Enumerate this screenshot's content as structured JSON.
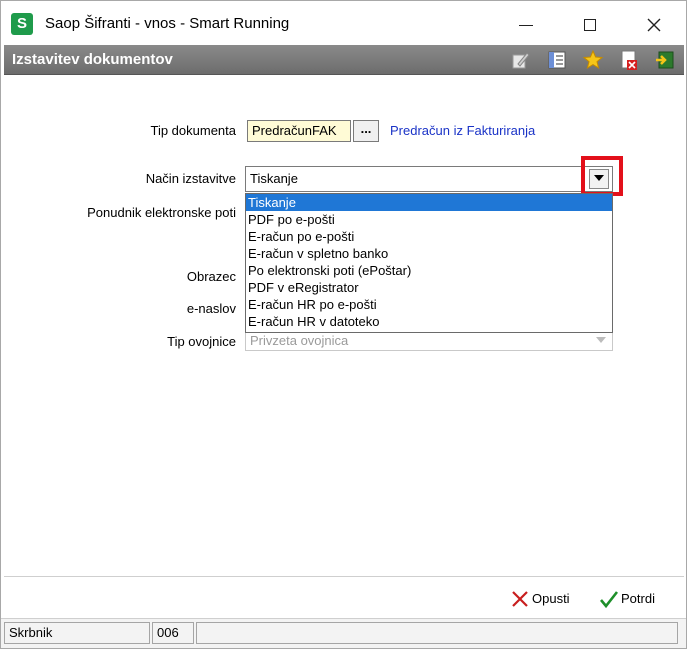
{
  "window": {
    "app_icon_letter": "S",
    "title": "Saop Šifranti - vnos - Smart Running"
  },
  "header": {
    "title": "Izstavitev dokumentov",
    "toolbar_icons": [
      "edit-icon",
      "list-icon",
      "star-icon",
      "delete-icon",
      "exit-icon"
    ]
  },
  "form": {
    "tip_dokumenta": {
      "label": "Tip dokumenta",
      "value": "PredračunFAK",
      "button_label": "...",
      "description": "Predračun iz Fakturiranja"
    },
    "nacin_izstavitve": {
      "label": "Način izstavitve",
      "value": "Tiskanje",
      "options": [
        "Tiskanje",
        "PDF po e-pošti",
        "E-račun po e-pošti",
        "E-račun v spletno banko",
        "Po elektronski poti (ePoštar)",
        "PDF v eRegistrator",
        "E-račun HR po e-pošti",
        "E-račun HR v datoteko"
      ],
      "selected_index": 0
    },
    "ponudnik_label": "Ponudnik elektronske poti",
    "obrazec_label": "Obrazec",
    "enaslov_label": "e-naslov",
    "tip_ovojnice": {
      "label": "Tip ovojnice",
      "value": "Privzeta ovojnica"
    }
  },
  "actions": {
    "cancel_label": "Opusti",
    "confirm_label": "Potrdi"
  },
  "status": {
    "user": "Skrbnik",
    "code": "006"
  },
  "colors": {
    "header_bg": "#7a7a7a",
    "link": "#1a33c7",
    "selection": "#1f77d6",
    "highlight": "#e3101a",
    "field_yellow": "#fffbd6"
  }
}
